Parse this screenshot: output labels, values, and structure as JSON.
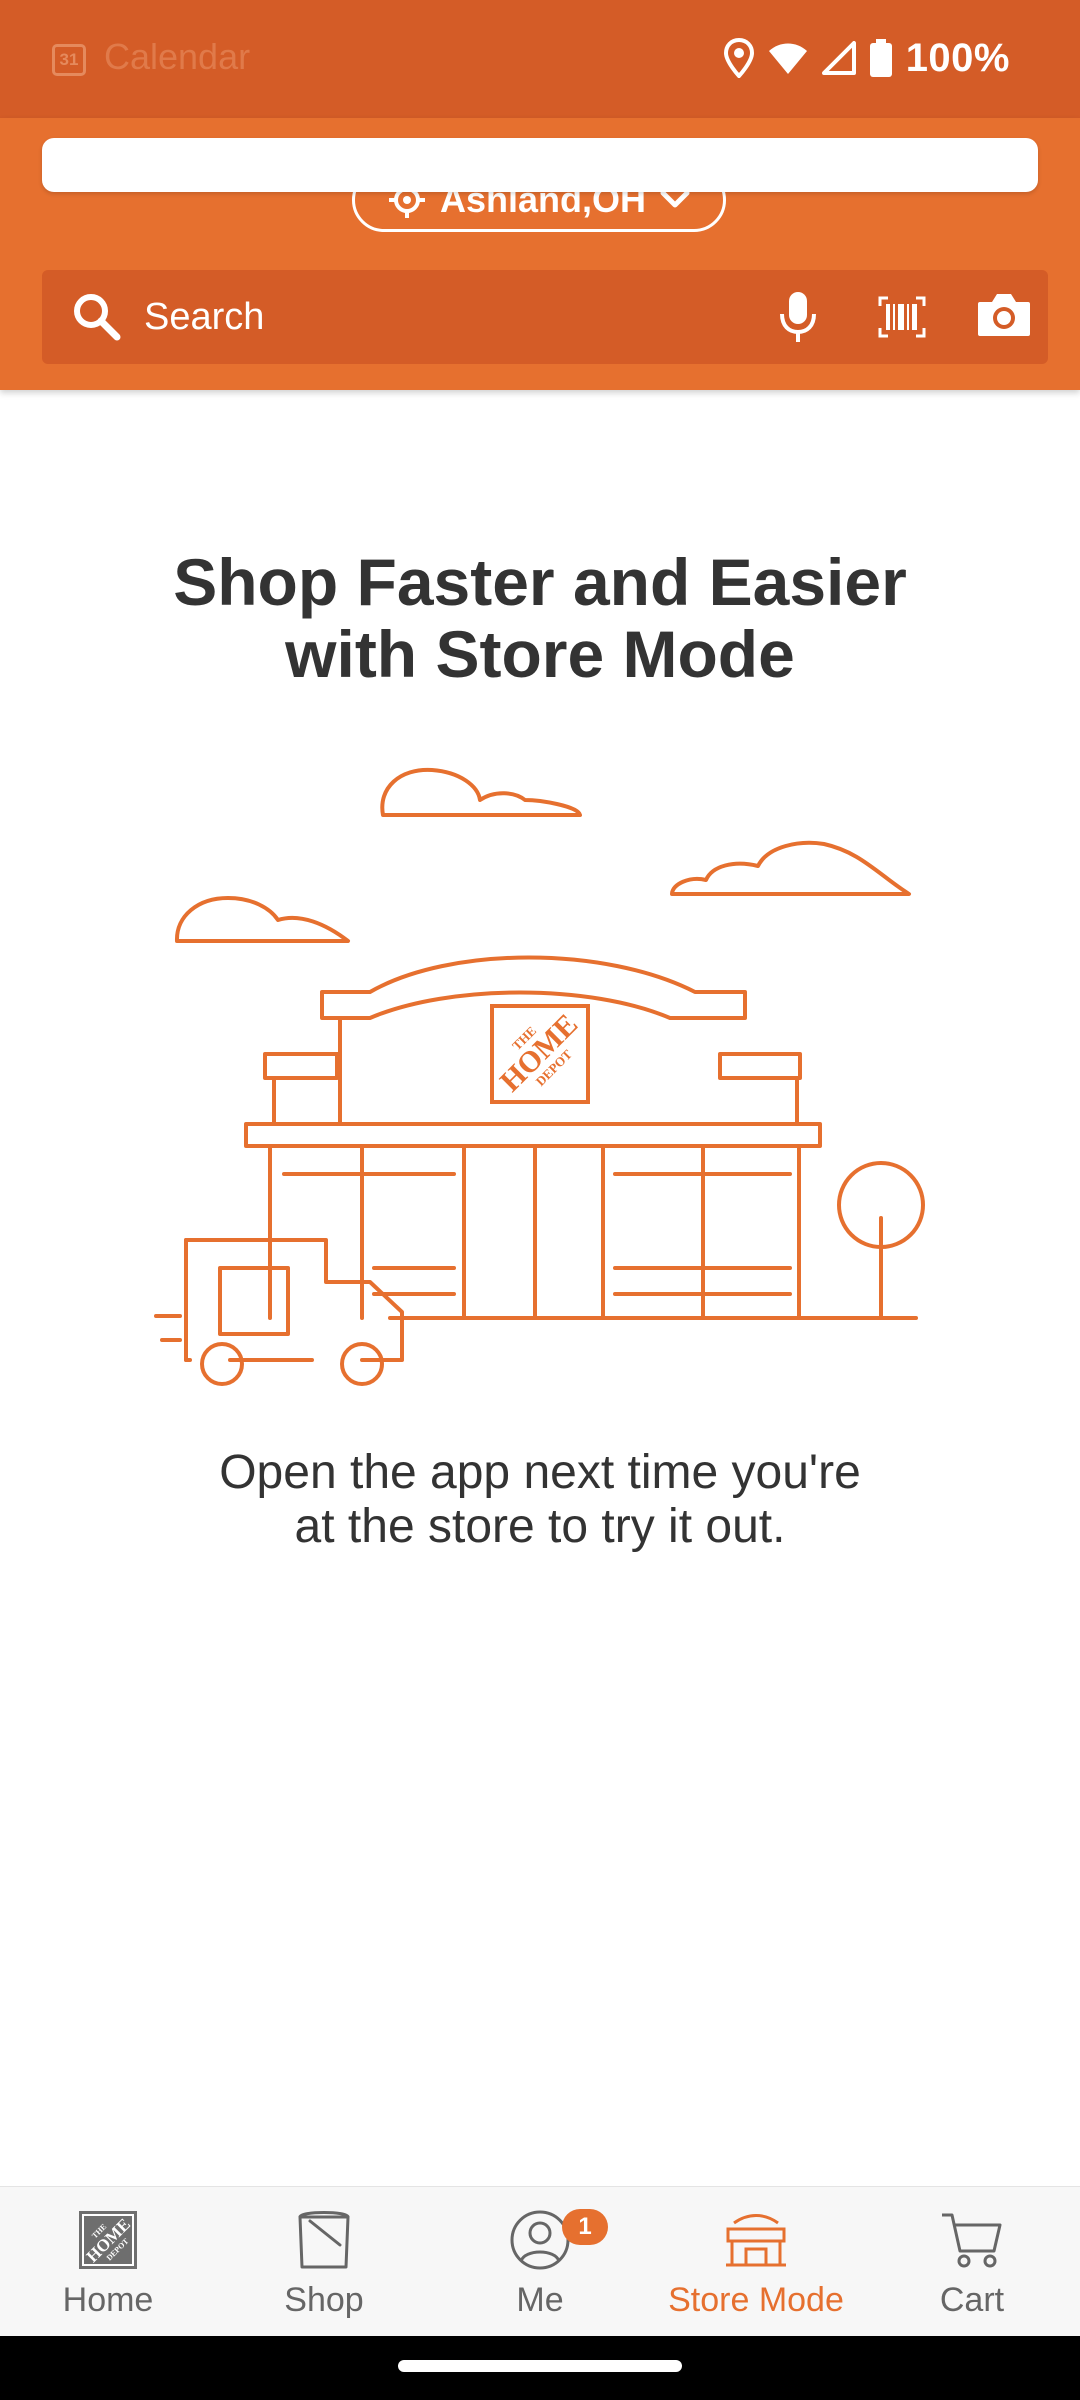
{
  "status_bar": {
    "app_name": "Calendar",
    "calendar_icon_text": "31",
    "battery": "100%"
  },
  "header": {
    "location": "Ashland,OH",
    "search_placeholder": "Search"
  },
  "main": {
    "title_line1": "Shop Faster and Easier",
    "title_line2": "with Store Mode",
    "subtitle_line1": "Open the app next time you're",
    "subtitle_line2": "at the store to try it out."
  },
  "illustration": {
    "logo_line1": "THE",
    "logo_line2": "HOME",
    "logo_line3": "DEPOT"
  },
  "bottom_nav": {
    "items": [
      {
        "label": "Home",
        "icon": "home-depot-logo-icon"
      },
      {
        "label": "Shop",
        "icon": "bucket-icon"
      },
      {
        "label": "Me",
        "icon": "user-icon",
        "badge": "1"
      },
      {
        "label": "Store Mode",
        "icon": "store-icon",
        "active": true
      },
      {
        "label": "Cart",
        "icon": "cart-icon"
      }
    ]
  },
  "colors": {
    "brand_orange": "#e6702f",
    "header_dark_orange": "#d45c27",
    "text_dark": "#333333",
    "nav_inactive": "#666666"
  }
}
